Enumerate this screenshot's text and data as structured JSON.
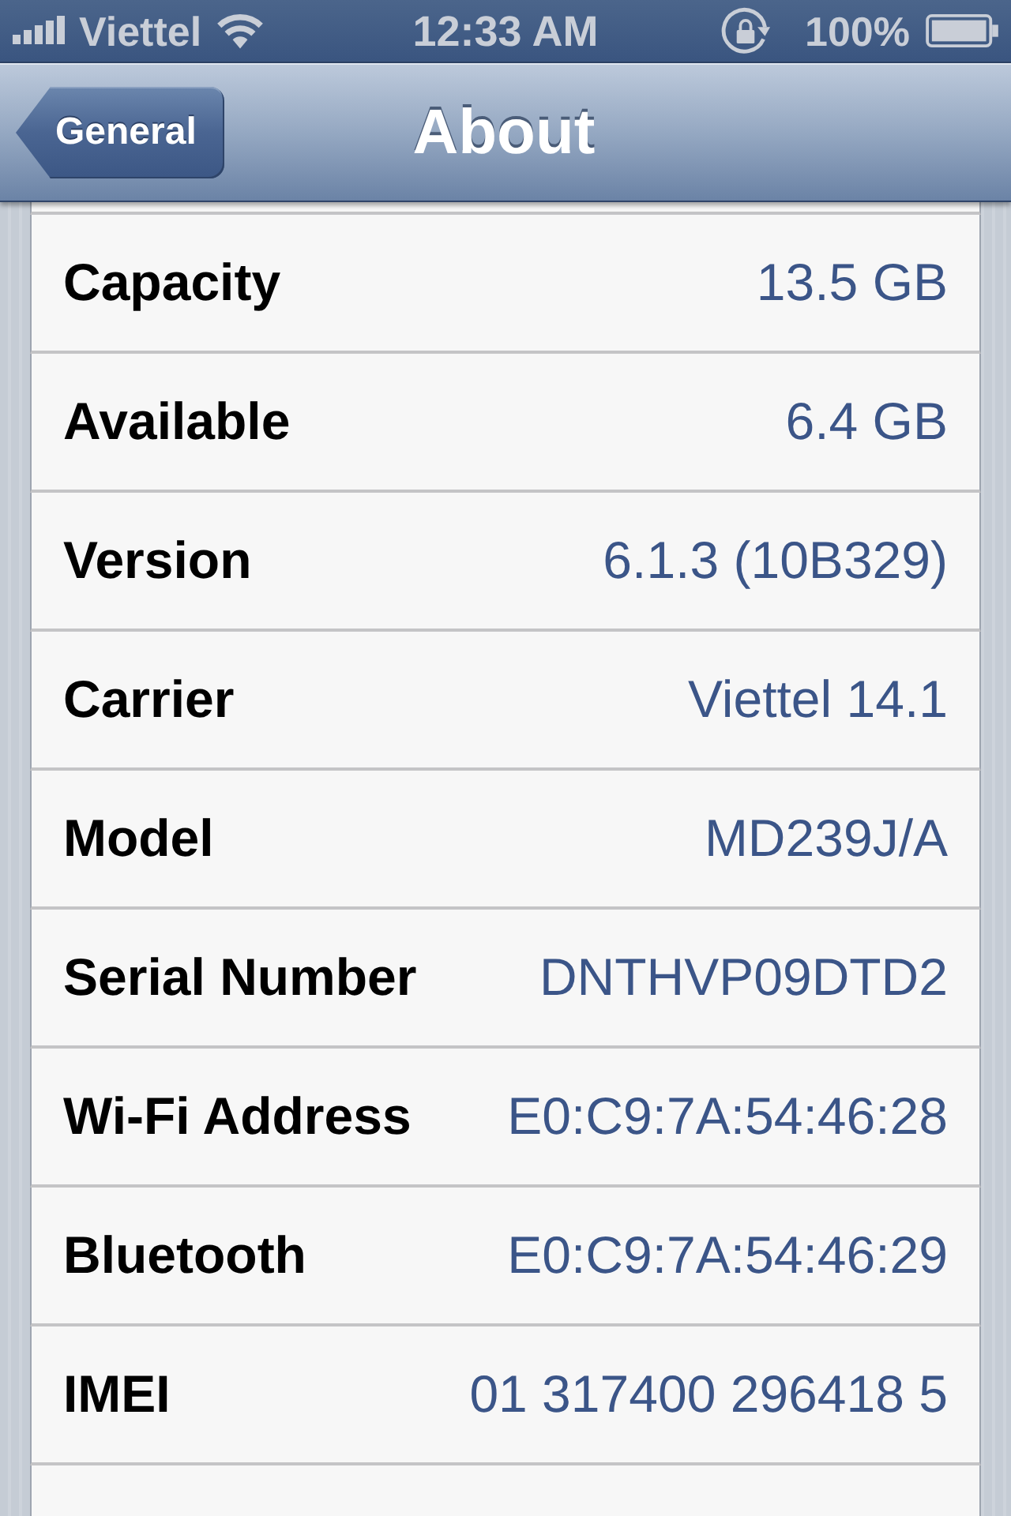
{
  "status_bar": {
    "carrier": "Viettel",
    "time": "12:33 AM",
    "battery": "100%"
  },
  "nav_bar": {
    "back_button": "General",
    "title": "About"
  },
  "rows": [
    {
      "label": "Capacity",
      "value": "13.5 GB"
    },
    {
      "label": "Available",
      "value": "6.4 GB"
    },
    {
      "label": "Version",
      "value": "6.1.3 (10B329)"
    },
    {
      "label": "Carrier",
      "value": "Viettel 14.1"
    },
    {
      "label": "Model",
      "value": "MD239J/A"
    },
    {
      "label": "Serial Number",
      "value": "DNTHVP09DTD2"
    },
    {
      "label": "Wi-Fi Address",
      "value": "E0:C9:7A:54:46:28"
    },
    {
      "label": "Bluetooth",
      "value": "E0:C9:7A:54:46:29"
    },
    {
      "label": "IMEI",
      "value": "01 317400 296418 5"
    }
  ]
}
